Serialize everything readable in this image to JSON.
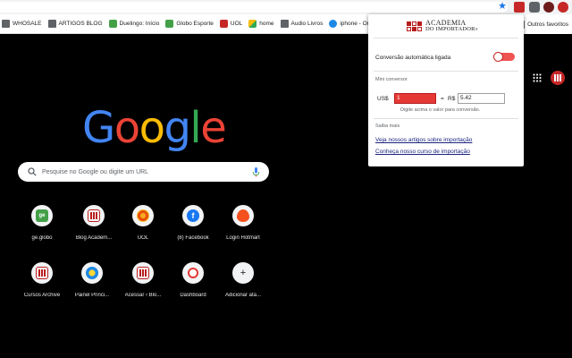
{
  "bookmarks_bar": {
    "items": [
      {
        "label": "WHOSALE",
        "icon": "folder-icon"
      },
      {
        "label": "ARTIGOS BLOG",
        "icon": "folder-icon"
      },
      {
        "label": "Duelingo: Início",
        "icon": "globo-ge-icon"
      },
      {
        "label": "Globo Esporte",
        "icon": "globo-ge-icon"
      },
      {
        "label": "UOL",
        "icon": "uol-icon"
      },
      {
        "label": "home",
        "icon": "home-icon"
      },
      {
        "label": "Audio Livros",
        "icon": "folder-icon"
      },
      {
        "label": "iphone - On",
        "icon": "cloud-icon"
      }
    ],
    "other_bookmarks": "Outros favoritos"
  },
  "google": {
    "logo_letters": [
      {
        "char": "G",
        "color": "#4285F4"
      },
      {
        "char": "o",
        "color": "#EA4335"
      },
      {
        "char": "o",
        "color": "#FBBC05"
      },
      {
        "char": "g",
        "color": "#4285F4"
      },
      {
        "char": "l",
        "color": "#34A853"
      },
      {
        "char": "e",
        "color": "#EA4335"
      }
    ],
    "search_placeholder": "Pesquise no Google ou digite um URL"
  },
  "shortcuts": [
    {
      "label": "ge.globo",
      "icon": "ge-icon",
      "text": "ge"
    },
    {
      "label": "Blog Academ...",
      "icon": "academia-icon"
    },
    {
      "label": "UOL",
      "icon": "uol-icon"
    },
    {
      "label": "(8) Facebook",
      "icon": "facebook-icon",
      "text": "f"
    },
    {
      "label": "Login Hotmart",
      "icon": "hotmart-icon"
    },
    {
      "label": "Cursos Archive",
      "icon": "academia-icon"
    },
    {
      "label": "Painel Princi...",
      "icon": "painel-icon"
    },
    {
      "label": "Acessar ‹ Blo...",
      "icon": "academia-icon"
    },
    {
      "label": "Dashboard",
      "icon": "dashboard-icon"
    },
    {
      "label": "Adicionar ata...",
      "icon": "plus-icon",
      "text": "+"
    }
  ],
  "popup": {
    "brand_line1": "ACADEMIA",
    "brand_line2": "DO IMPORTADOR",
    "brand_mark": "®",
    "auto_conversion_label": "Conversão automática ligada",
    "auto_conversion_on": true,
    "section_converter": "Mini conversor",
    "usd_label": "US$",
    "usd_value": "1",
    "equals": "=",
    "brl_label": "R$",
    "brl_value": "5.42",
    "converter_hint": "Digite acima o valor para conversão.",
    "section_more": "Saiba mais",
    "link_articles": "Veja nossos artigos sobre importação",
    "link_course": "Conheça nosso curso de importação"
  },
  "colors": {
    "brand_red": "#b71c1c",
    "toggle_on": "#ef5350",
    "link": "#1a237e"
  }
}
